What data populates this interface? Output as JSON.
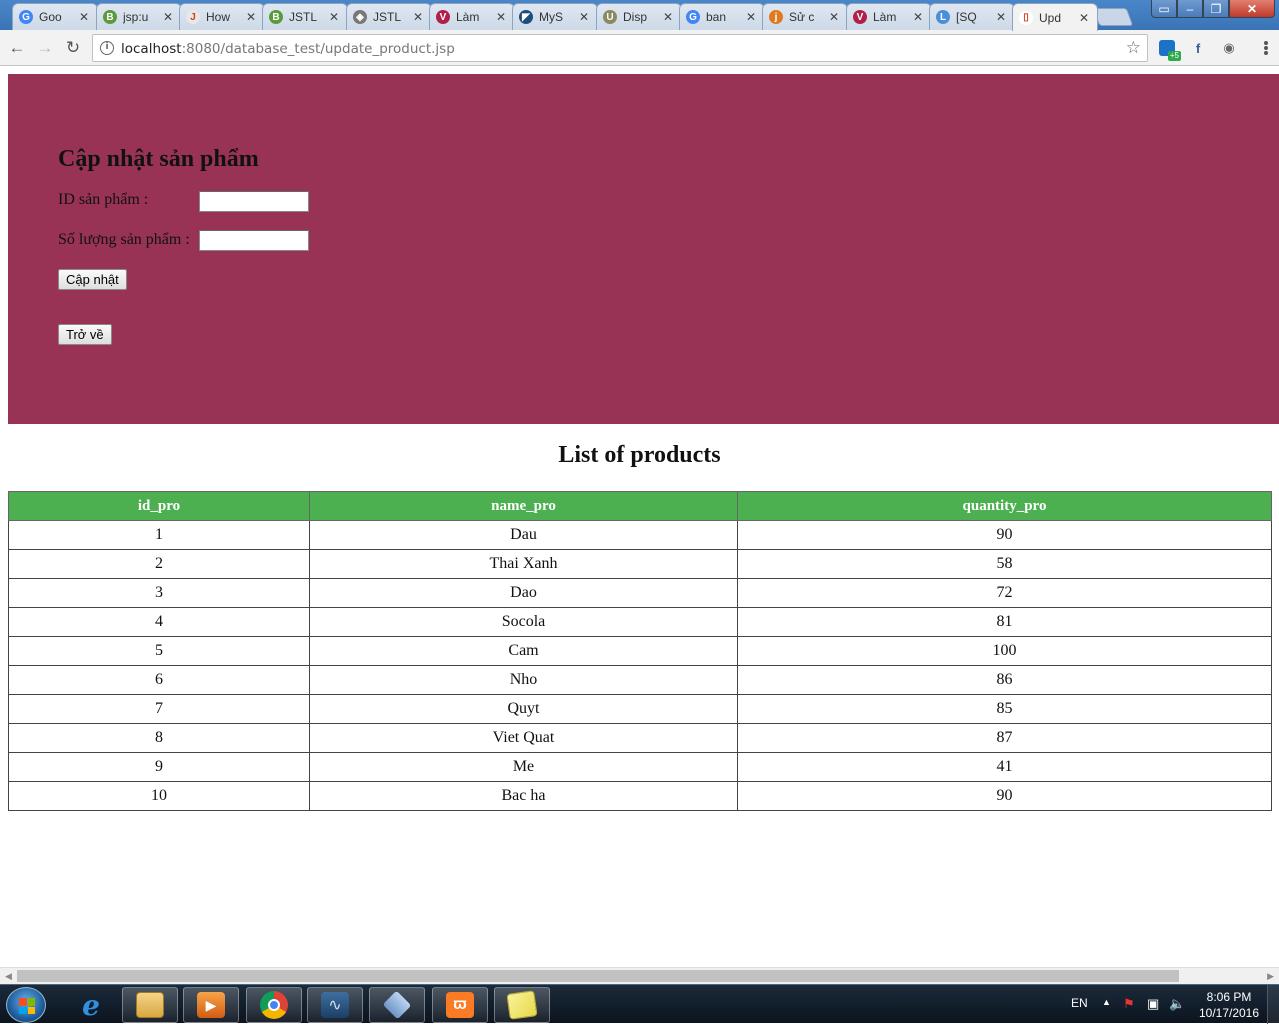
{
  "browser": {
    "tabs": [
      {
        "title": "Goo",
        "fav_color": "#4285f4",
        "fav_glyph": "G"
      },
      {
        "title": "jsp:u",
        "fav_color": "#5a9a3a",
        "fav_glyph": "B"
      },
      {
        "title": "How",
        "fav_color": "#e8e8e8",
        "fav_glyph": "J"
      },
      {
        "title": "JSTL",
        "fav_color": "#5a9a3a",
        "fav_glyph": "B"
      },
      {
        "title": "JSTL",
        "fav_color": "#777777",
        "fav_glyph": "◈"
      },
      {
        "title": "Làm",
        "fav_color": "#b0204a",
        "fav_glyph": "V"
      },
      {
        "title": "MyS",
        "fav_color": "#1e4f7a",
        "fav_glyph": "◤"
      },
      {
        "title": "Disp",
        "fav_color": "#8a8a60",
        "fav_glyph": "U"
      },
      {
        "title": "ban",
        "fav_color": "#4285f4",
        "fav_glyph": "G"
      },
      {
        "title": "Sử c",
        "fav_color": "#e07a20",
        "fav_glyph": "j"
      },
      {
        "title": "Làm",
        "fav_color": "#b0204a",
        "fav_glyph": "V"
      },
      {
        "title": "[SQ",
        "fav_color": "#4a90d9",
        "fav_glyph": "L"
      },
      {
        "title": "Upd",
        "fav_color": "#ffffff",
        "fav_glyph": "▯"
      }
    ],
    "url_host": "localhost",
    "url_path": ":8080/database_test/update_product.jsp",
    "extension_badge": "+5"
  },
  "form": {
    "title": "Cập nhật sản phẩm",
    "id_label": "ID sản phẩm :",
    "id_value": "",
    "qty_label": "Số lượng sản phẩm :",
    "qty_value": "",
    "submit_label": "Cập nhật",
    "back_label": "Trở về",
    "banner_color": "#993355"
  },
  "products": {
    "title": "List of products",
    "header_color": "#4caf50",
    "columns": [
      "id_pro",
      "name_pro",
      "quantity_pro"
    ],
    "rows": [
      [
        "1",
        "Dau",
        "90"
      ],
      [
        "2",
        "Thai Xanh",
        "58"
      ],
      [
        "3",
        "Dao",
        "72"
      ],
      [
        "4",
        "Socola",
        "81"
      ],
      [
        "5",
        "Cam",
        "100"
      ],
      [
        "6",
        "Nho",
        "86"
      ],
      [
        "7",
        "Quyt",
        "85"
      ],
      [
        "8",
        "Viet Quat",
        "87"
      ],
      [
        "9",
        "Me",
        "41"
      ],
      [
        "10",
        "Bac ha",
        "90"
      ]
    ]
  },
  "taskbar": {
    "apps": [
      "internet-explorer",
      "file-explorer",
      "media-player",
      "chrome",
      "mysql-workbench",
      "virtualbox",
      "xampp",
      "sticky-notes"
    ],
    "language": "EN",
    "time": "8:06 PM",
    "date": "10/17/2016"
  }
}
